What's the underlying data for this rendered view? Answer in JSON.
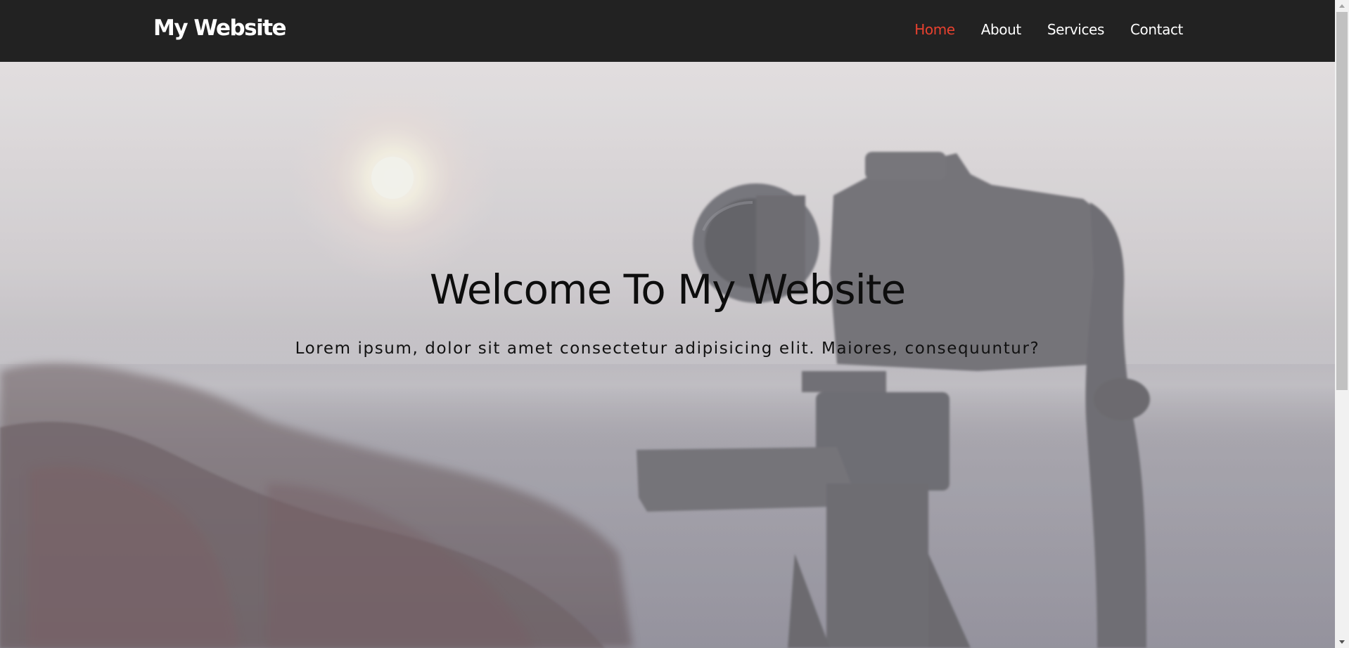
{
  "navbar": {
    "brand": "My Website",
    "links": [
      {
        "label": "Home",
        "active": true
      },
      {
        "label": "About",
        "active": false
      },
      {
        "label": "Services",
        "active": false
      },
      {
        "label": "Contact",
        "active": false
      }
    ],
    "background_color": "#222222",
    "active_color": "#e8412f"
  },
  "hero": {
    "title": "Welcome To My Website",
    "subtitle": "Lorem ipsum, dolor sit amet consectetur adipisicing elit. Maiores, consequuntur?"
  },
  "scrollbar": {
    "up_icon": "triangle-up-icon",
    "down_icon": "triangle-down-icon"
  }
}
